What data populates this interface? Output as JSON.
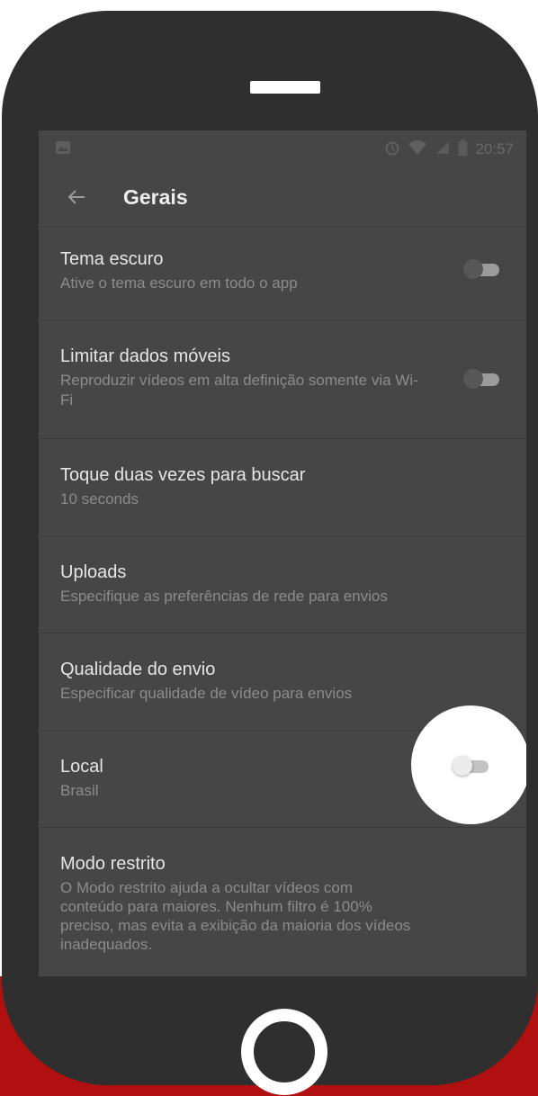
{
  "status_bar": {
    "time": "20:57",
    "left_icon": "image-icon",
    "right_icons": [
      "alarm-icon",
      "wifi-icon",
      "signal-icon",
      "battery-icon"
    ]
  },
  "app_bar": {
    "back_icon": "arrow-back-icon",
    "title": "Gerais"
  },
  "settings": [
    {
      "title": "Tema escuro",
      "subtitle": "Ative o tema escuro em todo o app",
      "toggle": "off"
    },
    {
      "title": "Limitar dados móveis",
      "subtitle": "Reproduzir vídeos em alta definição somente via Wi-Fi",
      "toggle": "off"
    },
    {
      "title": "Toque duas vezes para buscar",
      "subtitle": "10 seconds"
    },
    {
      "title": "Uploads",
      "subtitle": "Especifique as preferências de rede para envios"
    },
    {
      "title": "Qualidade do envio",
      "subtitle": "Especificar qualidade de vídeo para envios"
    },
    {
      "title": "Local",
      "subtitle": "Brasil"
    },
    {
      "title": "Modo restrito",
      "subtitle": "O Modo restrito ajuda a ocultar vídeos com conteúdo para maiores. Nenhum filtro é 100% preciso, mas evita a exibição da maioria dos vídeos inadequados.",
      "toggle": "off",
      "highlighted": true
    }
  ],
  "colors": {
    "phone_body": "#2f2f2f",
    "screen_dimmed": "#464646",
    "accent_background": "#b01010",
    "spotlight": "#ffffff"
  }
}
